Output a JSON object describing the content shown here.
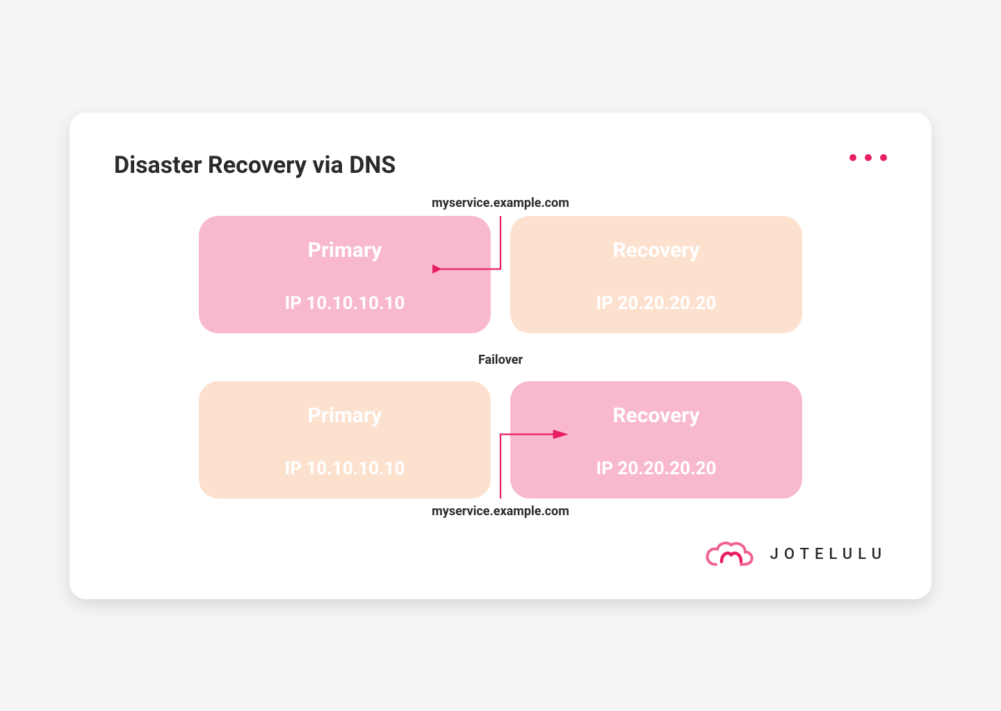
{
  "title": "Disaster Recovery via DNS",
  "hostname": "myservice.example.com",
  "failover_label": "Failover",
  "before": {
    "primary": {
      "label": "Primary",
      "ip": "IP 10.10.10.10",
      "active": true
    },
    "recovery": {
      "label": "Recovery",
      "ip": "IP 20.20.20.20",
      "active": false
    }
  },
  "after": {
    "primary": {
      "label": "Primary",
      "ip": "IP 10.10.10.10",
      "active": false
    },
    "recovery": {
      "label": "Recovery",
      "ip": "IP 20.20.20.20",
      "active": true
    }
  },
  "brand": "JOTELULU",
  "colors": {
    "accent": "#e91e63",
    "active_box": "#f8b9cd",
    "inactive_box": "#fce1cf"
  }
}
